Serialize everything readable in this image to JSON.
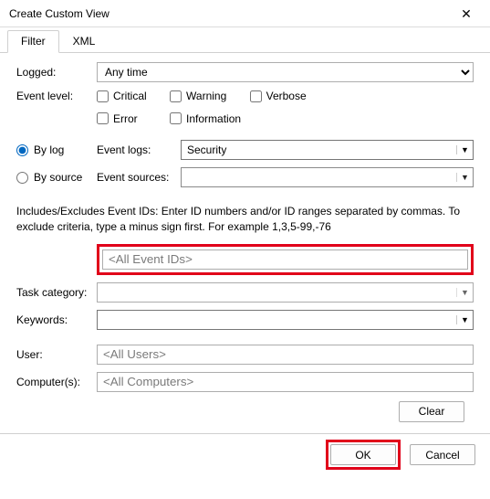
{
  "title": "Create Custom View",
  "tabs": {
    "filter": "Filter",
    "xml": "XML"
  },
  "labels": {
    "logged": "Logged:",
    "event_level": "Event level:",
    "by_log": "By log",
    "by_source": "By source",
    "event_logs": "Event logs:",
    "event_sources": "Event sources:",
    "task_category": "Task category:",
    "keywords": "Keywords:",
    "user": "User:",
    "computers": "Computer(s):"
  },
  "logged_value": "Any time",
  "levels": {
    "critical": "Critical",
    "warning": "Warning",
    "verbose": "Verbose",
    "error": "Error",
    "information": "Information"
  },
  "event_logs_value": "Security",
  "event_sources_value": "",
  "help_text": "Includes/Excludes Event IDs: Enter ID numbers and/or ID ranges separated by commas. To exclude criteria, type a minus sign first. For example 1,3,5-99,-76",
  "event_ids_placeholder": "<All Event IDs>",
  "user_placeholder": "<All Users>",
  "computers_placeholder": "<All Computers>",
  "buttons": {
    "clear": "Clear",
    "ok": "OK",
    "cancel": "Cancel"
  }
}
